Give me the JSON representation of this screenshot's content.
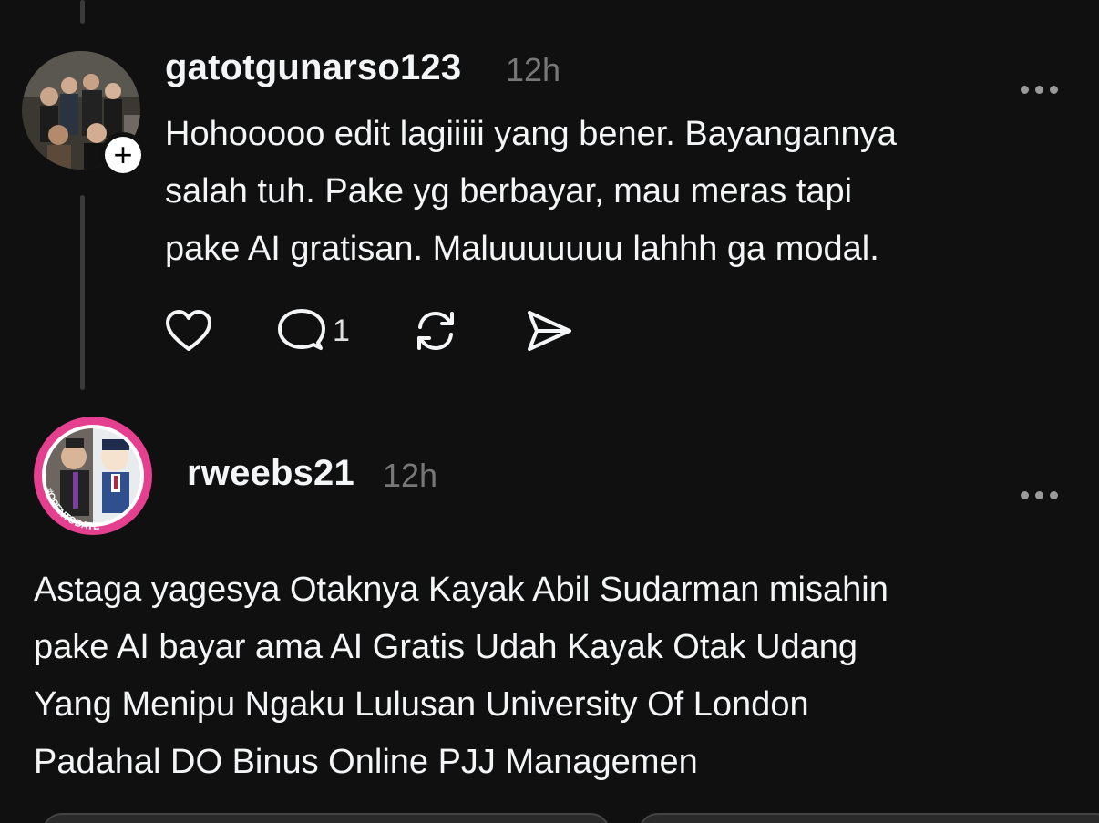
{
  "comments": [
    {
      "username": "gatotgunarso123",
      "time": "12h",
      "text_lines": [
        "Hohooooo edit lagiiiii yang bener. Bayangannya",
        "salah tuh. Pake yg berbayar, mau meras tapi",
        "pake AI gratisan. Maluuuuuuu lahhh ga modal."
      ],
      "reply_count": "1",
      "follow_symbol": "+"
    },
    {
      "username": "rweebs21",
      "time": "12h",
      "avatar_ring_text": "#OPENTODATE",
      "text_lines": [
        "Astaga yagesya Otaknya Kayak Abil Sudarman misahin",
        "pake AI bayar ama AI Gratis Udah Kayak Otak Udang",
        "Yang Menipu Ngaku Lulusan University Of London",
        "Padahal DO Binus Online PJJ Managemen"
      ]
    }
  ],
  "icons": {
    "like": "heart-icon",
    "reply": "comment-icon",
    "repost": "repost-icon",
    "share": "send-icon",
    "more": "more-icon"
  },
  "colors": {
    "background": "#101010",
    "text": "#f3f5f7",
    "muted": "#777777",
    "ring_pink": "#e5408f"
  }
}
